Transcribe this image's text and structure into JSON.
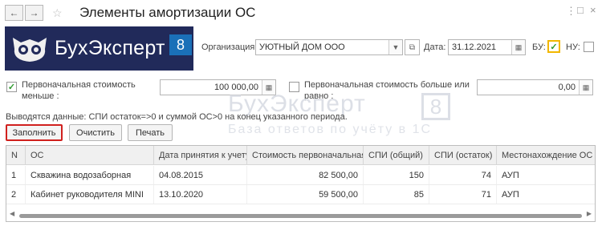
{
  "header": {
    "title": "Элементы амортизации ОС",
    "back_icon": "arrow-left-icon",
    "forward_icon": "arrow-right-icon",
    "star_icon": "star-icon",
    "more_icon": "more-vertical-icon",
    "restore_icon": "restore-window-icon",
    "close_icon": "close-icon"
  },
  "logo": {
    "text": "БухЭксперт",
    "badge": "8"
  },
  "filters": {
    "org_label": "Организация:",
    "org_value": "УЮТНЫЙ ДОМ ООО",
    "date_label": "Дата:",
    "date_value": "31.12.2021",
    "bu_label": "БУ:",
    "bu_checked": true,
    "nu_label": "НУ:",
    "nu_checked": false,
    "cost_less_label_1": "Первоначальная стоимость",
    "cost_less_label_2": "меньше :",
    "cost_less_checked": true,
    "cost_less_value": "100 000,00",
    "cost_more_label_1": "Первоначальная стоимость больше или",
    "cost_more_label_2": "равно :",
    "cost_more_checked": false,
    "cost_more_value": "0,00"
  },
  "info_text": "Выводятся данные: СПИ остаток=>0 и суммой ОС>0 на конец указанного периода.",
  "watermark": {
    "line1": "БухЭксперт",
    "badge": "8",
    "line2": "База ответов по учёту в 1С"
  },
  "commands": {
    "fill": "Заполнить",
    "clear": "Очистить",
    "print": "Печать"
  },
  "table": {
    "headers": [
      "N",
      "ОС",
      "Дата принятия к учету",
      "Стоимость первоначальная",
      "СПИ (общий)",
      "СПИ (остаток)",
      "Местонахождение ОС"
    ],
    "rows": [
      [
        "1",
        "Скважина водозаборная",
        "04.08.2015",
        "82 500,00",
        "150",
        "74",
        "АУП"
      ],
      [
        "2",
        "Кабинет руководителя MINI",
        "13.10.2020",
        "59 500,00",
        "85",
        "71",
        "АУП"
      ]
    ]
  },
  "colors": {
    "accent_red": "#d0201e",
    "logo_bg": "#212a5a",
    "logo_badge": "#1a70b8",
    "check_green": "#2e9a2e",
    "highlight_yellow": "#f2b700"
  }
}
